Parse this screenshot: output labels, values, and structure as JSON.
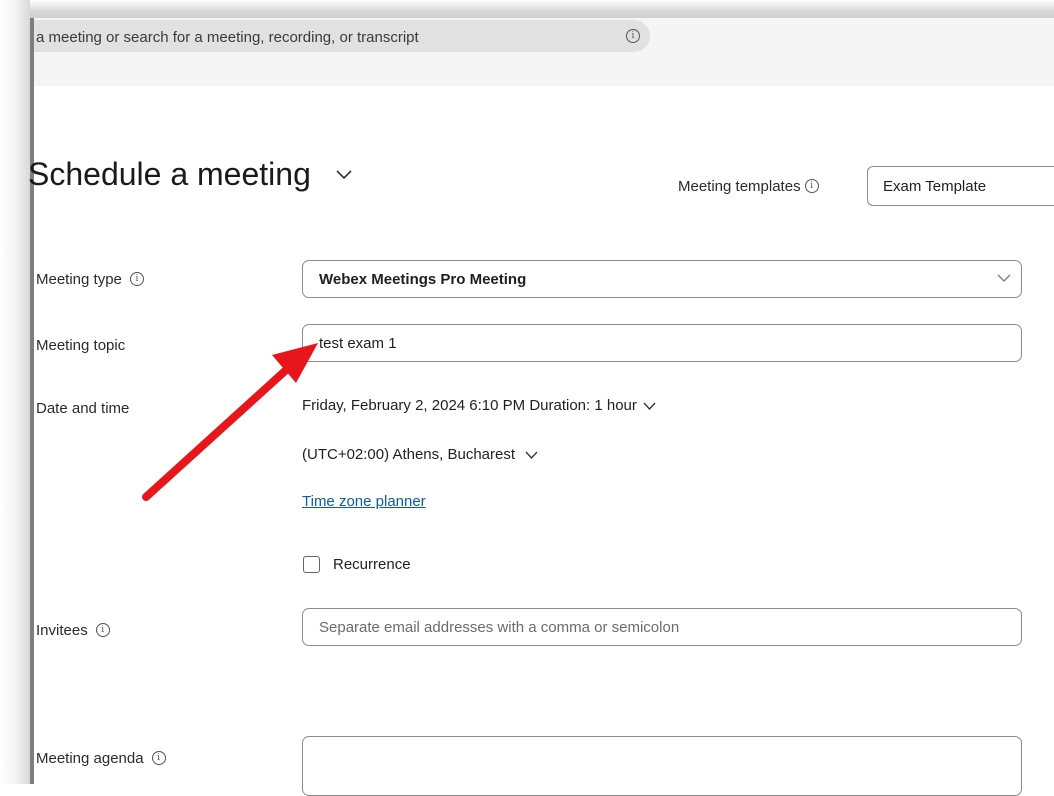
{
  "search": {
    "text": "a meeting or search for a meeting, recording, or transcript"
  },
  "page": {
    "title": "Schedule a meeting"
  },
  "templates": {
    "label": "Meeting templates",
    "selected": "Exam Template"
  },
  "form": {
    "meeting_type": {
      "label": "Meeting type",
      "value": "Webex Meetings Pro Meeting"
    },
    "meeting_topic": {
      "label": "Meeting topic",
      "value": "test exam 1"
    },
    "date_time": {
      "label": "Date and time",
      "value": "Friday, February 2, 2024 6:10 PM Duration: 1 hour",
      "timezone": "(UTC+02:00) Athens, Bucharest",
      "timezone_link": "Time zone planner"
    },
    "recurrence": {
      "label": "Recurrence",
      "checked": false
    },
    "invitees": {
      "label": "Invitees",
      "placeholder": "Separate email addresses with a comma or semicolon"
    },
    "agenda": {
      "label": "Meeting agenda"
    }
  },
  "annotation": {
    "arrow_color": "#e8161b"
  },
  "colors": {
    "link": "#0b5cad",
    "border": "#8c8c8c"
  },
  "icons": {
    "info": "info-icon",
    "chevron": "chevron-down-icon",
    "arrow": "red-arrow-annotation"
  }
}
